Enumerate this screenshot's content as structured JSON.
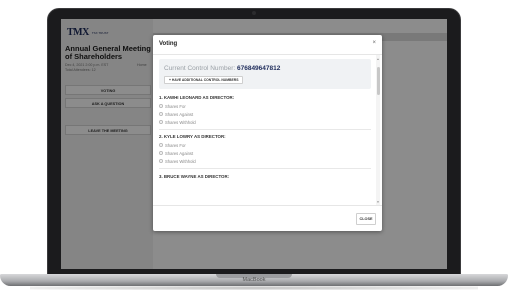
{
  "app": {
    "logo_text": "TMX",
    "logo_sub": "TSX TRUST",
    "meeting_title": "Annual General Meeting of Shareholders",
    "meeting_date": "Dec 4, 2021 2:00 p.m. EST",
    "attendees": "Total Attendees: 12",
    "home_link": "Home",
    "side_buttons": [
      {
        "label": "VOTING"
      },
      {
        "label": "ASK A QUESTION"
      },
      {
        "label": "LEAVE THE MEETING"
      }
    ]
  },
  "modal": {
    "title": "Voting",
    "close_icon": "×",
    "control_label": "Current Control Number:",
    "control_number": "676849647812",
    "add_button": "+ HAVE ADDITIONAL CONTROL NUMBERS",
    "questions": [
      {
        "title": "1. KAWHI LEONARD AS DIRECTOR:",
        "options": [
          "Shares For",
          "Shares Against",
          "Shares Withhold"
        ]
      },
      {
        "title": "2. KYLE LOWRY AS DIRECTOR:",
        "options": [
          "Shares For",
          "Shares Against",
          "Shares Withhold"
        ]
      },
      {
        "title": "3. BRUCE WAYNE AS DIRECTOR:",
        "options": []
      }
    ],
    "close_button": "CLOSE"
  },
  "device": {
    "brand": "MacBook"
  },
  "icons": {
    "close": "close-icon",
    "radio": "radio-icon",
    "scroll_up": "chevron-up-icon",
    "scroll_down": "chevron-down-icon"
  },
  "colors": {
    "brand_navy": "#1d2b5a",
    "overlay": "rgba(0,0,0,0.45)"
  }
}
